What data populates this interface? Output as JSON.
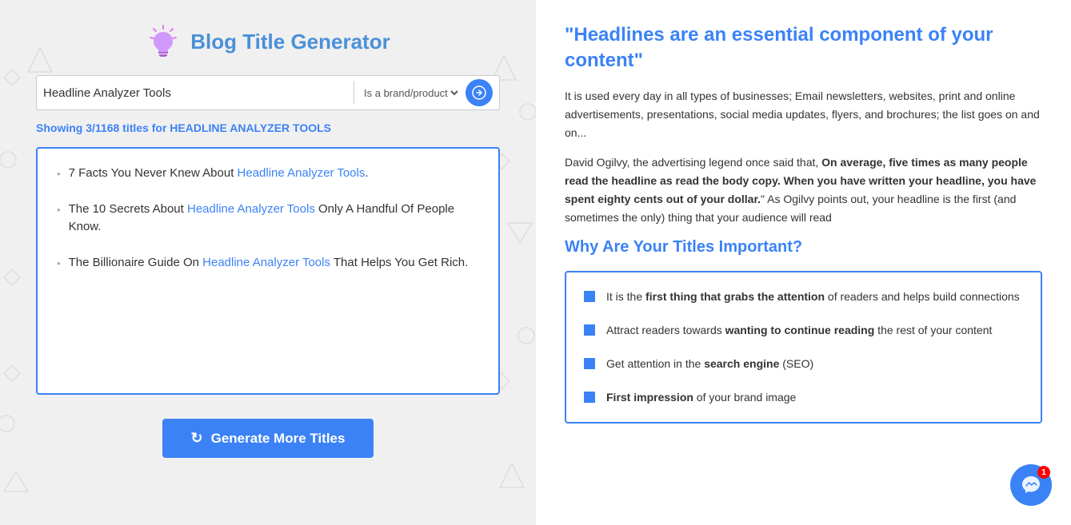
{
  "left": {
    "logo_title": "Blog Title Generator",
    "search_value": "Headline Analyzer Tools",
    "select_option": "Is a brand/product",
    "showing_prefix": "Showing ",
    "showing_count": "3/1168",
    "showing_middle": " titles for ",
    "showing_keyword": "HEADLINE ANALYZER TOOLS",
    "results": [
      {
        "text_before": "7 Facts You Never Knew About ",
        "link_text": "Headline Analyzer Tools",
        "text_after": "."
      },
      {
        "text_before": "The 10 Secrets About ",
        "link_text": "Headline Analyzer Tools",
        "text_after": " Only A Handful Of People Know."
      },
      {
        "text_before": "The Billionaire Guide On ",
        "link_text": "Headline Analyzer Tools",
        "text_after": " That Helps You Get Rich."
      }
    ],
    "generate_btn": "Generate More Titles"
  },
  "right": {
    "quote": "\"Headlines are an essential component of your content\"",
    "para1": "It is used every day in all types of businesses; Email newsletters, websites, print and online advertisements, presentations, social media updates, flyers, and brochures; the list goes on and on...",
    "para2_before": "David Ogilvy, the advertising legend once said that, ",
    "para2_bold": "On average, five times as many people read the headline as read the body copy. When you have written your headline, you have spent eighty cents out of your dollar.",
    "para2_after": "\" As Ogilvy points out, your headline is the first (and sometimes the only) thing that your audience will read",
    "section_title": "Why Are Your Titles Important?",
    "bullets": [
      {
        "bold": "first thing that grabs the attention",
        "before": "It is the ",
        "after": " of readers and helps build connections"
      },
      {
        "bold": "wanting to continue reading",
        "before": "Attract readers towards ",
        "after": " the rest of your content"
      },
      {
        "bold": "search engine",
        "before": "Get attention in the ",
        "after": " (SEO)"
      },
      {
        "bold": "First impression",
        "before": "",
        "after": " of your brand image"
      }
    ]
  },
  "chat": {
    "badge": "1"
  }
}
